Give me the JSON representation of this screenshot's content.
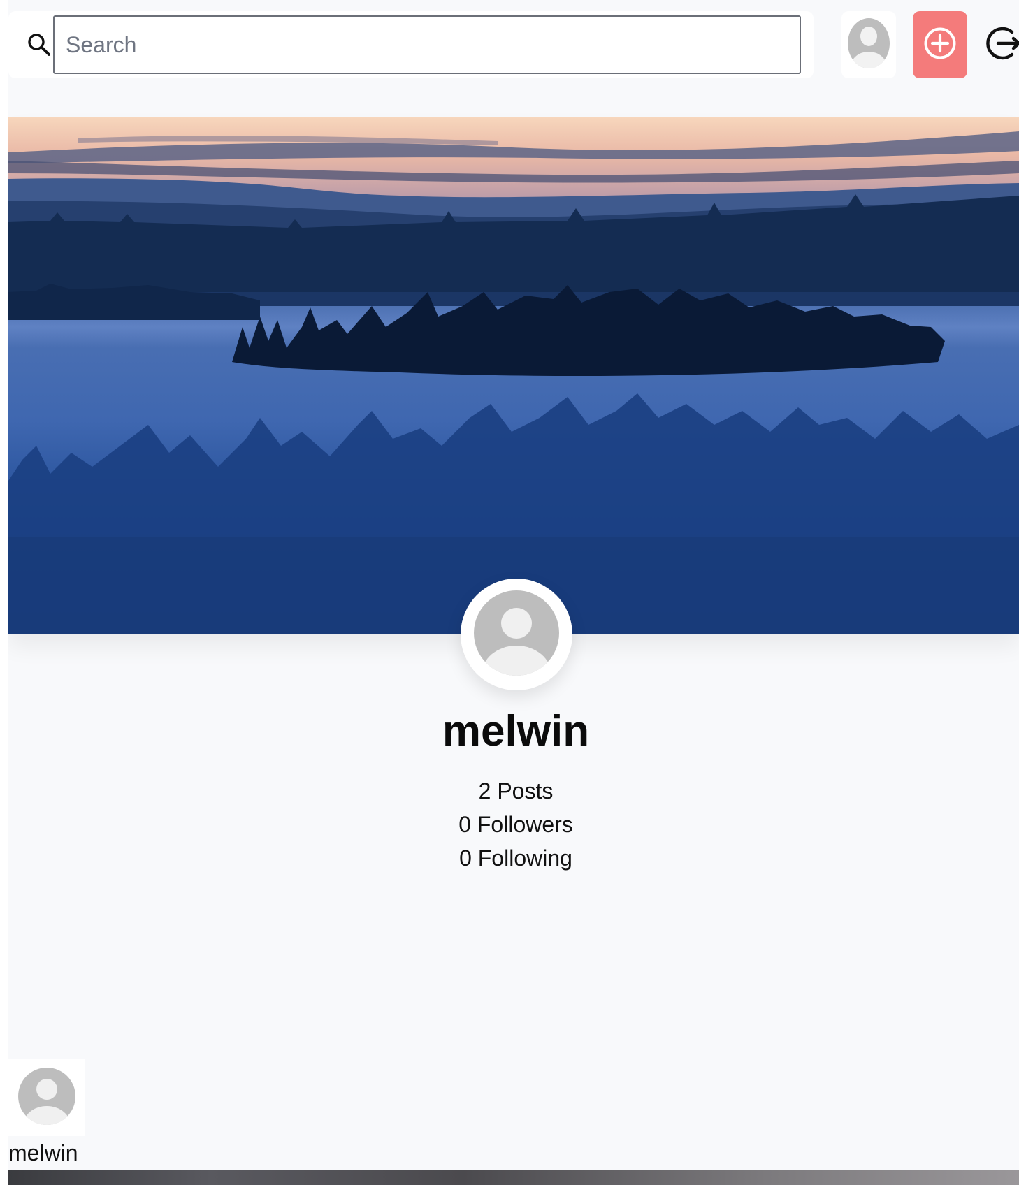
{
  "topbar": {
    "search": {
      "placeholder": "Search",
      "value": ""
    },
    "icons": {
      "search": "search-icon",
      "avatar": "user-avatar-icon",
      "add": "plus-circle-icon",
      "logout": "logout-icon"
    },
    "add_button_color": "#f47b7b"
  },
  "profile": {
    "username": "melwin",
    "posts": "2 Posts",
    "followers": "0 Followers",
    "following": "0 Following"
  },
  "posts": [
    {
      "username": "melwin"
    }
  ],
  "colors": {
    "background": "#f8f9fb",
    "accent": "#f47b7b",
    "avatar_gray": "#bdbdbd"
  }
}
